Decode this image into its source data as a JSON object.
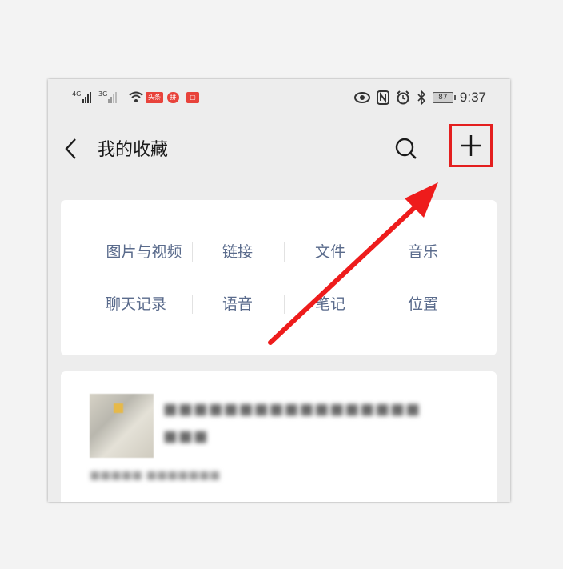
{
  "status_bar": {
    "sim1": "4G",
    "sim2": "3G",
    "app_badge1": "头条",
    "app_badge2": "拼",
    "battery": "87",
    "time": "9:37"
  },
  "header": {
    "title": "我的收藏"
  },
  "categories": [
    {
      "label": "图片与视频"
    },
    {
      "label": "链接"
    },
    {
      "label": "文件"
    },
    {
      "label": "音乐"
    },
    {
      "label": "聊天记录"
    },
    {
      "label": "语音"
    },
    {
      "label": "笔记"
    },
    {
      "label": "位置"
    }
  ],
  "favorite_item": {
    "title_line1": "■■■■■■■■■■■■■■■■■",
    "title_line2": "■■■",
    "meta": "■■■■■ ■■■■■■■"
  },
  "colors": {
    "highlight": "#e41f1f",
    "category_text": "#5a6b8c"
  },
  "icons": [
    "back-arrow-icon",
    "search-icon",
    "add-icon",
    "eye-icon",
    "nfc-icon",
    "alarm-icon",
    "bluetooth-icon",
    "wifi-icon",
    "battery-icon"
  ]
}
